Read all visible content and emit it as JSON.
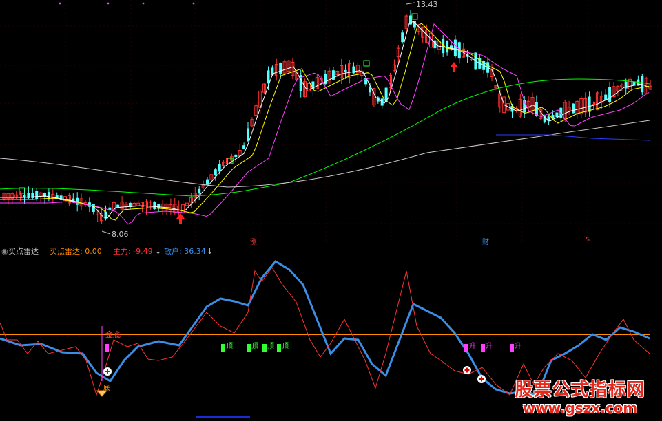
{
  "upper_chart": {
    "price_high_label": "13.43",
    "price_low_label": "8.06",
    "markers": [
      {
        "label": "涨",
        "color": "#e33b3b"
      },
      {
        "label": "财",
        "color": "#3399ff"
      },
      {
        "label": "$",
        "color": "#e33b3b"
      }
    ]
  },
  "indicator_bar": {
    "name": "买点雷达",
    "value_label": "买点雷达: 0.00",
    "main_force": "主力: -9.49",
    "retail": "散户: 36.34"
  },
  "lower_chart": {
    "labels": {
      "gold_bottom": "金底",
      "bottom": "底",
      "top": "顶",
      "rise": "升"
    }
  },
  "watermark": {
    "title": "股票公式指标网",
    "url": "www.gszx.com"
  },
  "colors": {
    "up": "#ff3333",
    "down": "#54ffff",
    "ma5": "#ffffff",
    "ma10": "#ffff00",
    "ma20": "#ff40ff",
    "ma60": "#00ff00",
    "ma120": "#c8c8c8",
    "main_line": "#ff3333",
    "retail_line": "#3a8ee6",
    "zero_line": "#ff8c00"
  }
}
